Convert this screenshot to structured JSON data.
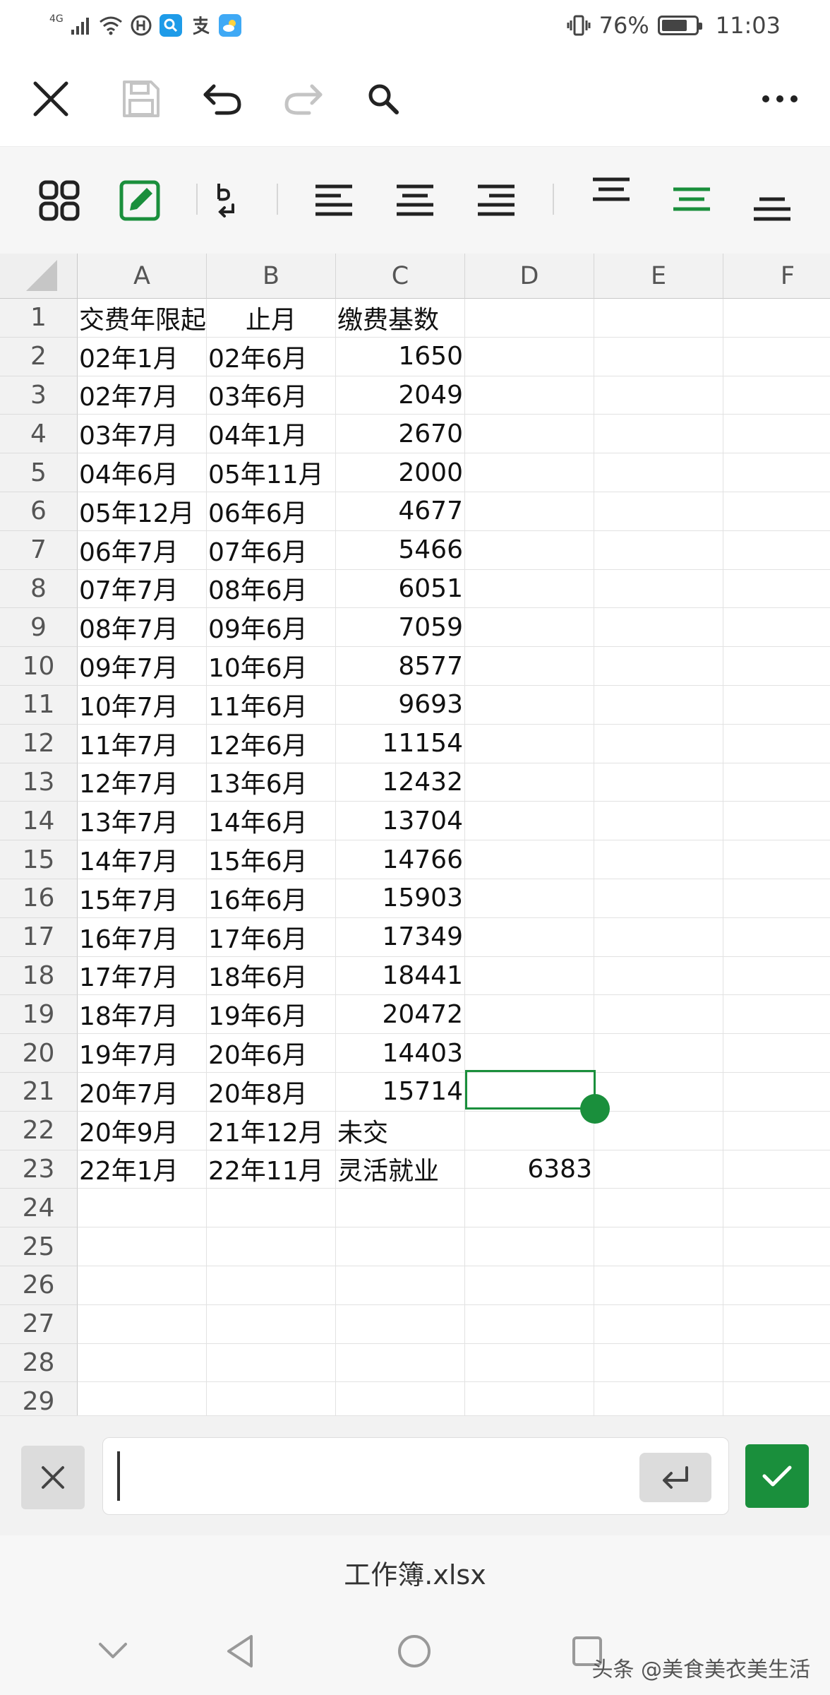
{
  "status_bar": {
    "network": "4G",
    "battery_text": "76%",
    "battery_level": 0.76,
    "time": "11:03"
  },
  "toolbar": {
    "icons": [
      "close-icon",
      "save-icon",
      "undo-icon",
      "redo-icon",
      "search-icon",
      "more-icon"
    ]
  },
  "format_toolbar": {
    "icons": [
      "apps-grid-icon",
      "edit-icon",
      "wrap-text-icon",
      "align-left-icon",
      "align-center-icon",
      "align-right-icon",
      "valign-top-icon",
      "valign-middle-icon",
      "valign-bottom-icon"
    ],
    "accent_color": "#1a8f3c"
  },
  "sheet": {
    "columns": [
      "A",
      "B",
      "C",
      "D",
      "E",
      "F"
    ],
    "rows": [
      {
        "num": "1",
        "cells": [
          "交费年限起",
          "止月",
          "缴费基数",
          "",
          "",
          ""
        ]
      },
      {
        "num": "2",
        "cells": [
          "02年1月",
          "02年6月",
          "1650",
          "",
          "",
          ""
        ]
      },
      {
        "num": "3",
        "cells": [
          "02年7月",
          "03年6月",
          "2049",
          "",
          "",
          ""
        ]
      },
      {
        "num": "4",
        "cells": [
          "03年7月",
          "04年1月",
          "2670",
          "",
          "",
          ""
        ]
      },
      {
        "num": "5",
        "cells": [
          "04年6月",
          "05年11月",
          "2000",
          "",
          "",
          ""
        ]
      },
      {
        "num": "6",
        "cells": [
          "05年12月",
          "06年6月",
          "4677",
          "",
          "",
          ""
        ]
      },
      {
        "num": "7",
        "cells": [
          "06年7月",
          "07年6月",
          "5466",
          "",
          "",
          ""
        ]
      },
      {
        "num": "8",
        "cells": [
          "07年7月",
          "08年6月",
          "6051",
          "",
          "",
          ""
        ]
      },
      {
        "num": "9",
        "cells": [
          "08年7月",
          "09年6月",
          "7059",
          "",
          "",
          ""
        ]
      },
      {
        "num": "10",
        "cells": [
          "09年7月",
          "10年6月",
          "8577",
          "",
          "",
          ""
        ]
      },
      {
        "num": "11",
        "cells": [
          "10年7月",
          "11年6月",
          "9693",
          "",
          "",
          ""
        ]
      },
      {
        "num": "12",
        "cells": [
          "11年7月",
          "12年6月",
          "11154",
          "",
          "",
          ""
        ]
      },
      {
        "num": "13",
        "cells": [
          "12年7月",
          "13年6月",
          "12432",
          "",
          "",
          ""
        ]
      },
      {
        "num": "14",
        "cells": [
          "13年7月",
          "14年6月",
          "13704",
          "",
          "",
          ""
        ]
      },
      {
        "num": "15",
        "cells": [
          "14年7月",
          "15年6月",
          "14766",
          "",
          "",
          ""
        ]
      },
      {
        "num": "16",
        "cells": [
          "15年7月",
          "16年6月",
          "15903",
          "",
          "",
          ""
        ]
      },
      {
        "num": "17",
        "cells": [
          "16年7月",
          "17年6月",
          "17349",
          "",
          "",
          ""
        ]
      },
      {
        "num": "18",
        "cells": [
          "17年7月",
          "18年6月",
          "18441",
          "",
          "",
          ""
        ]
      },
      {
        "num": "19",
        "cells": [
          "18年7月",
          "19年6月",
          "20472",
          "",
          "",
          ""
        ]
      },
      {
        "num": "20",
        "cells": [
          "19年7月",
          "20年6月",
          "14403",
          "",
          "",
          ""
        ]
      },
      {
        "num": "21",
        "cells": [
          "20年7月",
          "20年8月",
          "15714",
          "",
          "",
          ""
        ]
      },
      {
        "num": "22",
        "cells": [
          "20年9月",
          "21年12月",
          "未交",
          "",
          "",
          ""
        ]
      },
      {
        "num": "23",
        "cells": [
          "22年1月",
          "22年11月",
          "灵活就业",
          "6383",
          "",
          ""
        ]
      },
      {
        "num": "24",
        "cells": [
          "",
          "",
          "",
          "",
          "",
          ""
        ]
      },
      {
        "num": "25",
        "cells": [
          "",
          "",
          "",
          "",
          "",
          ""
        ]
      },
      {
        "num": "26",
        "cells": [
          "",
          "",
          "",
          "",
          "",
          ""
        ]
      },
      {
        "num": "27",
        "cells": [
          "",
          "",
          "",
          "",
          "",
          ""
        ]
      },
      {
        "num": "28",
        "cells": [
          "",
          "",
          "",
          "",
          "",
          ""
        ]
      },
      {
        "num": "29",
        "cells": [
          "",
          "",
          "",
          "",
          "",
          ""
        ]
      }
    ],
    "selected_cell": "D21"
  },
  "edit_bar": {
    "input_value": ""
  },
  "file": {
    "name": "工作簿.xlsx"
  },
  "watermark": "头条 @美食美衣美生活"
}
